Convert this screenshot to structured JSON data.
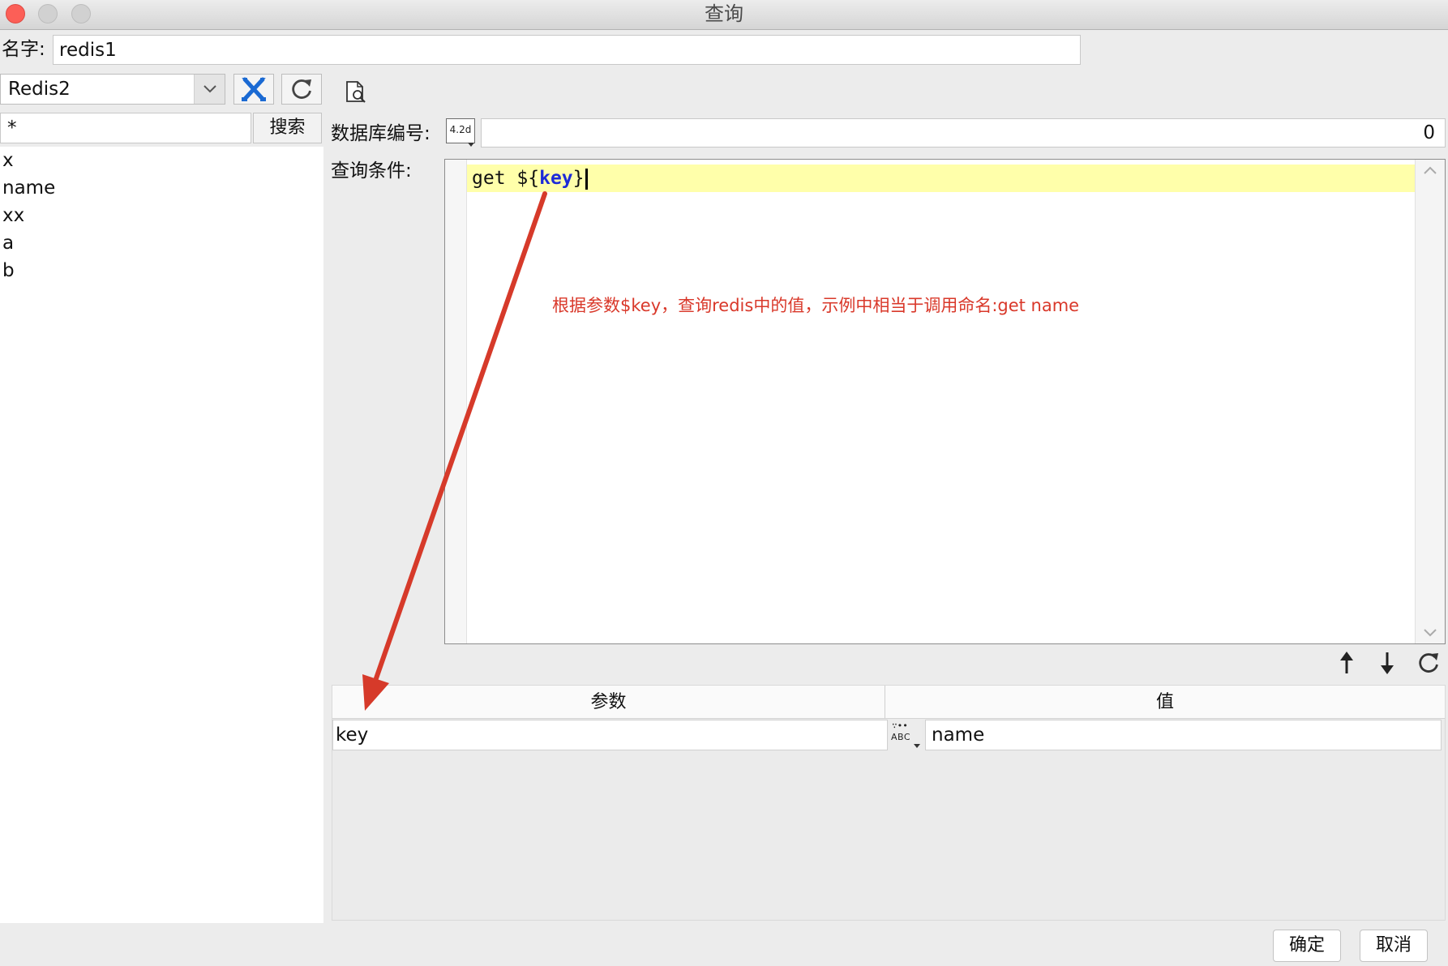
{
  "window": {
    "title": "查询"
  },
  "name_row": {
    "label": "名字:",
    "value": "redis1"
  },
  "datasource": {
    "selected": "Redis2"
  },
  "search": {
    "value": "*",
    "button_label": "搜索"
  },
  "key_list": [
    "x",
    "name",
    "xx",
    "a",
    "b"
  ],
  "db_number": {
    "label": "数据库编号:",
    "type_icon_text": "4.2d",
    "value": "0"
  },
  "query": {
    "label": "查询条件:",
    "code_prefix": "get ${",
    "code_param": "key",
    "code_suffix": "}",
    "annotation": "根据参数$key，查询redis中的值，示例中相当于调用命名:get name"
  },
  "params_table": {
    "columns": [
      "参数",
      "值"
    ],
    "rows": [
      {
        "param": "key",
        "type_icon_text": "ABC",
        "value": "name"
      }
    ]
  },
  "buttons": {
    "ok": "确定",
    "cancel": "取消"
  },
  "colors": {
    "close_light": "#fc5f57",
    "tools_icon": "#1b6ad3",
    "code_param": "#1d2bd8",
    "current_line": "#ffffaa",
    "annotation": "#d9382a",
    "arrow": "#d63a2a"
  },
  "icons": {
    "datasource_dropdown": "chevron-down-icon",
    "tools": "tools-icon",
    "refresh": "refresh-icon",
    "preview": "document-search-icon",
    "db_type": "number-type-icon",
    "scroll_up": "chevron-up-icon",
    "scroll_down": "chevron-down-icon",
    "move_up": "arrow-up-icon",
    "move_down": "arrow-down-icon",
    "reload": "refresh-icon",
    "param_type": "text-type-icon"
  }
}
